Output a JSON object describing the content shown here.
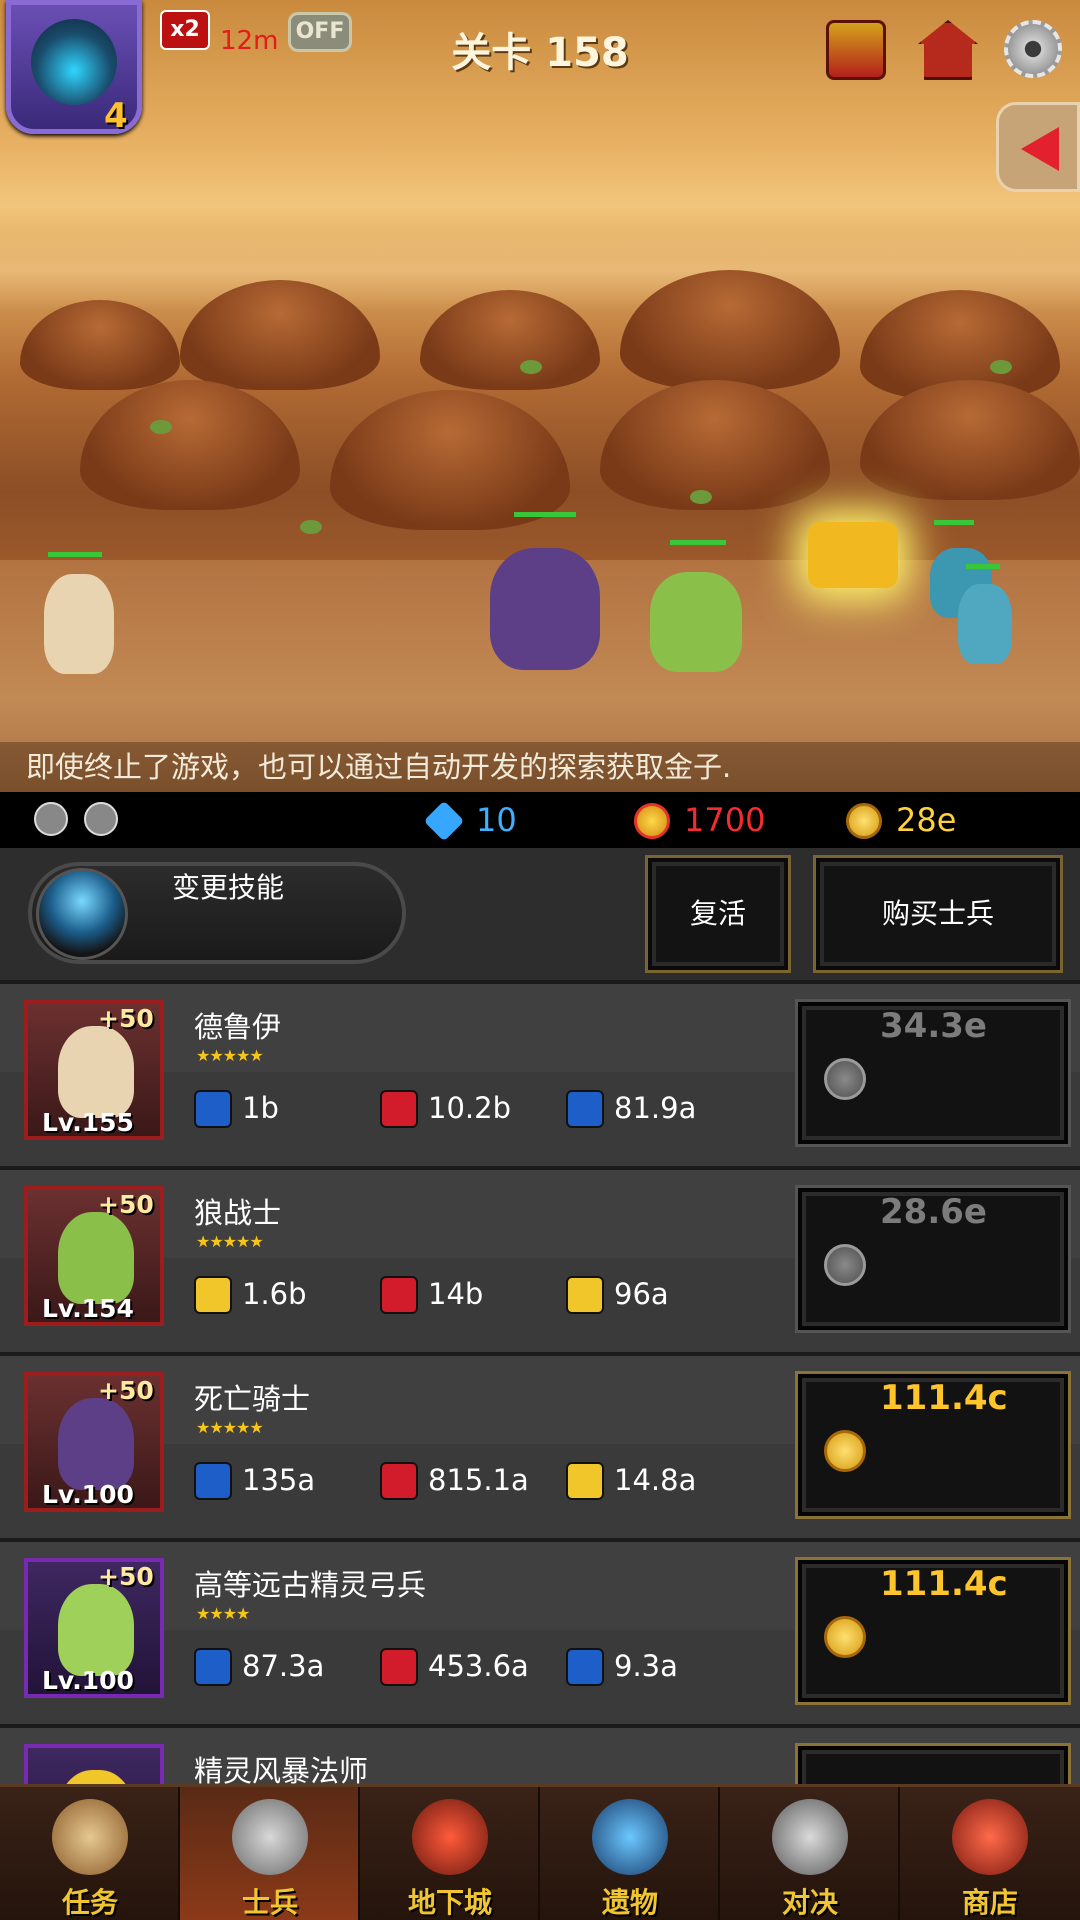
{
  "hud": {
    "avatar_level": "4",
    "speed_label": "x2",
    "speed_timer": "12m",
    "auto_toggle": "OFF",
    "stage_title": "关卡 158"
  },
  "hint_text": "即使终止了游戏，也可以通过自动开发的探索获取金子.",
  "currency": {
    "gems": "10",
    "medals": "1700",
    "gold": "28e"
  },
  "actions": {
    "skill_label": "变更技能",
    "revive_label": "复活",
    "buy_label": "购买士兵"
  },
  "soldiers": [
    {
      "name": "德鲁伊",
      "bonus": "+50",
      "level": "Lv.155",
      "stars": "★★★★★",
      "atk": "1b",
      "atk_type": "magic",
      "hp": "10.2b",
      "def": "81.9a",
      "def_type": "blue",
      "price": "34.3e",
      "affordable": false
    },
    {
      "name": "狼战士",
      "bonus": "+50",
      "level": "Lv.154",
      "stars": "★★★★★",
      "atk": "1.6b",
      "atk_type": "sword",
      "hp": "14b",
      "def": "96a",
      "def_type": "yellow",
      "price": "28.6e",
      "affordable": false
    },
    {
      "name": "死亡骑士",
      "bonus": "+50",
      "level": "Lv.100",
      "stars": "★★★★★",
      "atk": "135a",
      "atk_type": "magic",
      "hp": "815.1a",
      "def": "14.8a",
      "def_type": "yellow",
      "price": "111.4c",
      "affordable": true
    },
    {
      "name": "高等远古精灵弓兵",
      "bonus": "+50",
      "level": "Lv.100",
      "stars": "★★★★",
      "atk": "87.3a",
      "atk_type": "magic",
      "hp": "453.6a",
      "def": "9.3a",
      "def_type": "blue",
      "price": "111.4c",
      "affordable": true
    },
    {
      "name": "精灵风暴法师",
      "bonus": "",
      "level": "",
      "stars": "",
      "atk": "",
      "atk_type": "magic",
      "hp": "",
      "def": "",
      "def_type": "blue",
      "price": "",
      "affordable": true
    }
  ],
  "nav": [
    {
      "label": "任务",
      "icon": "scroll-icon",
      "active": false
    },
    {
      "label": "士兵",
      "icon": "soldier-helmet-icon",
      "active": true
    },
    {
      "label": "地下城",
      "icon": "monster-plant-icon",
      "active": false
    },
    {
      "label": "遗物",
      "icon": "relic-orb-icon",
      "active": false
    },
    {
      "label": "对决",
      "icon": "crossed-swords-icon",
      "active": false
    },
    {
      "label": "商店",
      "icon": "shop-icon",
      "active": false
    }
  ],
  "colors": {
    "accent_gold": "#ffc52a",
    "medal_red": "#f32d2d",
    "gem_blue": "#3db0ff",
    "nav_label": "#f0c531"
  }
}
